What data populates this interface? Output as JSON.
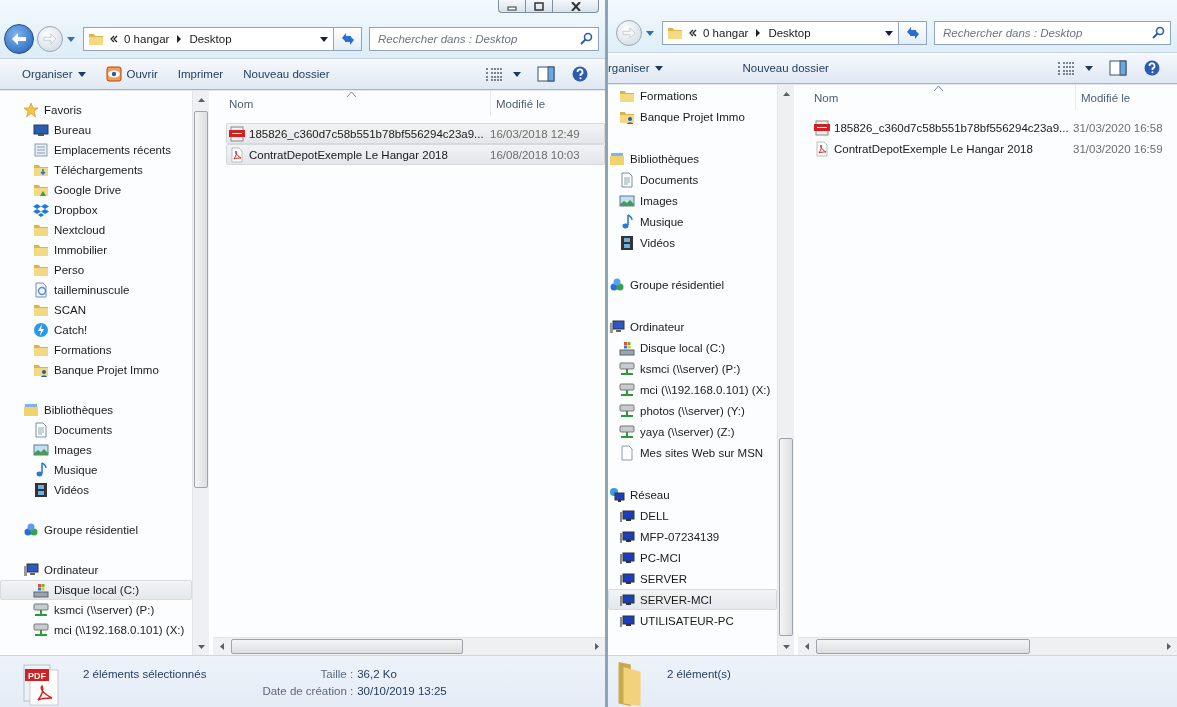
{
  "windows": [
    {
      "caption_buttons": [
        {
          "kind": "minimize"
        },
        {
          "kind": "maximize"
        },
        {
          "kind": "close"
        }
      ],
      "address": {
        "crumbs": [
          "0 hangar",
          "Desktop"
        ]
      },
      "search": {
        "placeholder": "Rechercher dans : Desktop"
      },
      "toolbar": [
        {
          "label": "Organiser",
          "kind": "menu"
        },
        {
          "label": "Ouvrir",
          "kind": "open"
        },
        {
          "label": "Imprimer",
          "kind": "plain"
        },
        {
          "label": "Nouveau dossier",
          "kind": "plain"
        }
      ],
      "nav": [
        {
          "label": "Favoris",
          "kind": "star",
          "selected": false,
          "children": [
            {
              "label": "Bureau",
              "kind": "desktop",
              "selected": false
            },
            {
              "label": "Emplacements récents",
              "kind": "recent",
              "selected": false
            },
            {
              "label": "Téléchargements",
              "kind": "downloads",
              "selected": false
            },
            {
              "label": "Google Drive",
              "kind": "gdrive",
              "selected": false
            },
            {
              "label": "Dropbox",
              "kind": "dropbox",
              "selected": false
            },
            {
              "label": "Nextcloud",
              "kind": "folder",
              "selected": false
            },
            {
              "label": "Immobilier",
              "kind": "folder",
              "selected": false
            },
            {
              "label": "Perso",
              "kind": "folder",
              "selected": false
            },
            {
              "label": "tailleminuscule",
              "kind": "sync",
              "selected": false
            },
            {
              "label": "SCAN",
              "kind": "folder",
              "selected": false
            },
            {
              "label": "Catch!",
              "kind": "catch",
              "selected": false
            },
            {
              "label": "Formations",
              "kind": "folder",
              "selected": false
            },
            {
              "label": "Banque Projet Immo",
              "kind": "user-folder",
              "selected": false
            }
          ]
        },
        {
          "label": "Bibliothèques",
          "kind": "library",
          "selected": false,
          "children": [
            {
              "label": "Documents",
              "kind": "documents",
              "selected": false
            },
            {
              "label": "Images",
              "kind": "pictures",
              "selected": false
            },
            {
              "label": "Musique",
              "kind": "music",
              "selected": false
            },
            {
              "label": "Vidéos",
              "kind": "videos",
              "selected": false
            }
          ]
        },
        {
          "label": "Groupe résidentiel",
          "kind": "homegroup",
          "selected": false
        },
        {
          "label": "Ordinateur",
          "kind": "computer",
          "selected": false,
          "children": [
            {
              "label": "Disque local (C:)",
              "kind": "system-drive",
              "selected": true
            },
            {
              "label": "ksmci (\\\\server) (P:)",
              "kind": "net-drive",
              "selected": false
            },
            {
              "label": "mci (\\\\192.168.0.101) (X:)",
              "kind": "net-drive",
              "selected": false
            }
          ]
        }
      ],
      "columns": [
        "Nom",
        "Modifié le"
      ],
      "files": [
        {
          "name": "185826_c360d7c58b551b78bf556294c23a9...",
          "modified": "16/03/2018 12:49",
          "kind": "jpg",
          "selected": true
        },
        {
          "name": "ContratDepotExemple Le Hangar 2018",
          "modified": "16/08/2018 10:03",
          "kind": "pdf",
          "selected": true
        }
      ],
      "status": {
        "kind": "pdf-stack",
        "icon_label": "PDF",
        "summary": "2 éléments sélectionnés",
        "details": [
          {
            "label": "Taille :",
            "value": "36,2 Ko"
          },
          {
            "label": "Date de création :",
            "value": "30/10/2019 13:25"
          }
        ]
      }
    },
    {
      "address": {
        "crumbs": [
          "0 hangar",
          "Desktop"
        ]
      },
      "search": {
        "placeholder": "Rechercher dans : Desktop"
      },
      "toolbar": [
        {
          "label": "rganiser",
          "kind": "menu"
        },
        {
          "label": "Nouveau dossier",
          "kind": "plain"
        }
      ],
      "nav": [
        {
          "children": [
            {
              "label": "Formations",
              "kind": "folder",
              "selected": false
            },
            {
              "label": "Banque Projet Immo",
              "kind": "user-folder",
              "selected": false
            }
          ]
        },
        {
          "label": "Bibliothèques",
          "kind": "library",
          "selected": false,
          "children": [
            {
              "label": "Documents",
              "kind": "documents",
              "selected": false
            },
            {
              "label": "Images",
              "kind": "pictures",
              "selected": false
            },
            {
              "label": "Musique",
              "kind": "music",
              "selected": false
            },
            {
              "label": "Vidéos",
              "kind": "videos",
              "selected": false
            }
          ]
        },
        {
          "label": "Groupe résidentiel",
          "kind": "homegroup",
          "selected": false
        },
        {
          "label": "Ordinateur",
          "kind": "computer",
          "selected": false,
          "children": [
            {
              "label": "Disque local (C:)",
              "kind": "system-drive",
              "selected": false
            },
            {
              "label": "ksmci (\\\\server) (P:)",
              "kind": "net-drive",
              "selected": false
            },
            {
              "label": "mci (\\\\192.168.0.101) (X:)",
              "kind": "net-drive",
              "selected": false
            },
            {
              "label": "photos (\\\\server) (Y:)",
              "kind": "net-drive",
              "selected": false
            },
            {
              "label": "yaya (\\\\server) (Z:)",
              "kind": "net-drive",
              "selected": false
            },
            {
              "label": "Mes sites Web sur MSN",
              "kind": "page",
              "selected": false
            }
          ]
        },
        {
          "label": "Réseau",
          "kind": "network",
          "selected": false,
          "children": [
            {
              "label": "DELL",
              "kind": "pc",
              "selected": false
            },
            {
              "label": "MFP-07234139",
              "kind": "pc",
              "selected": false
            },
            {
              "label": "PC-MCI",
              "kind": "pc",
              "selected": false
            },
            {
              "label": "SERVER",
              "kind": "pc",
              "selected": false
            },
            {
              "label": "SERVER-MCI",
              "kind": "pc",
              "selected": true
            },
            {
              "label": "UTILISATEUR-PC",
              "kind": "pc",
              "selected": false
            }
          ]
        }
      ],
      "columns": [
        "Nom",
        "Modifié le"
      ],
      "files": [
        {
          "name": "185826_c360d7c58b551b78bf556294c23a9...",
          "modified": "31/03/2020 16:58",
          "kind": "jpg",
          "selected": false
        },
        {
          "name": "ContratDepotExemple Le Hangar 2018",
          "modified": "31/03/2020 16:59",
          "kind": "pdf",
          "selected": false
        }
      ],
      "status": {
        "kind": "folder",
        "summary": "2 élément(s)"
      }
    }
  ]
}
